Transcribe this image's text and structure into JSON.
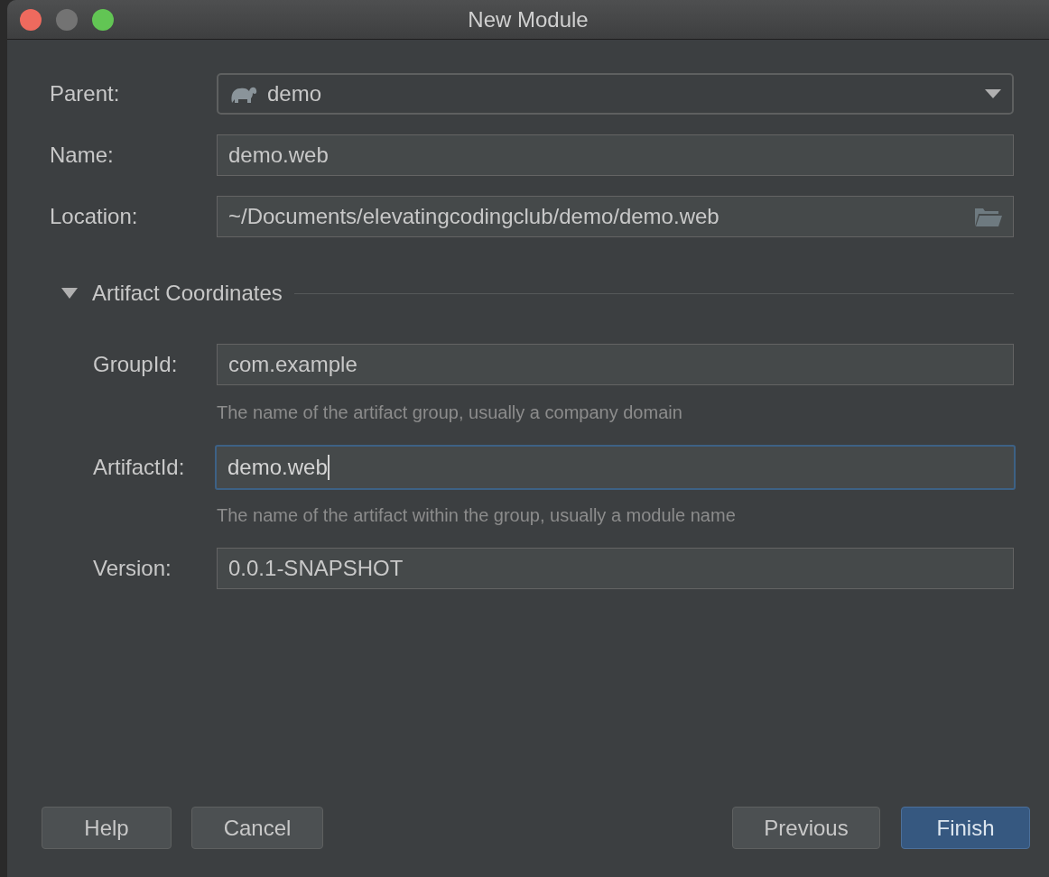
{
  "window": {
    "title": "New Module"
  },
  "fields": [
    {
      "kind": "dropdown",
      "label": "Parent:",
      "value": "demo",
      "focused": false
    },
    {
      "kind": "text",
      "label": "Name:",
      "value": "demo.web",
      "focused": false
    },
    {
      "kind": "path",
      "label": "Location:",
      "value": "~/Documents/elevatingcodingclub/demo/demo.web",
      "focused": false
    }
  ],
  "section": {
    "title": "Artifact Coordinates",
    "expanded": true,
    "fields": [
      {
        "label": "GroupId:",
        "value": "com.example",
        "hint": "The name of the artifact group, usually a company domain",
        "focused": false
      },
      {
        "label": "ArtifactId:",
        "value": "demo.web",
        "hint": "The name of the artifact within the group, usually a module name",
        "focused": true
      },
      {
        "label": "Version:",
        "value": "0.0.1-SNAPSHOT",
        "focused": false
      }
    ]
  },
  "buttons_left": [
    {
      "label": "Help",
      "default": false
    },
    {
      "label": "Cancel",
      "default": false
    }
  ],
  "buttons_right": [
    {
      "label": "Previous",
      "default": false
    },
    {
      "label": "Finish",
      "default": true
    }
  ]
}
